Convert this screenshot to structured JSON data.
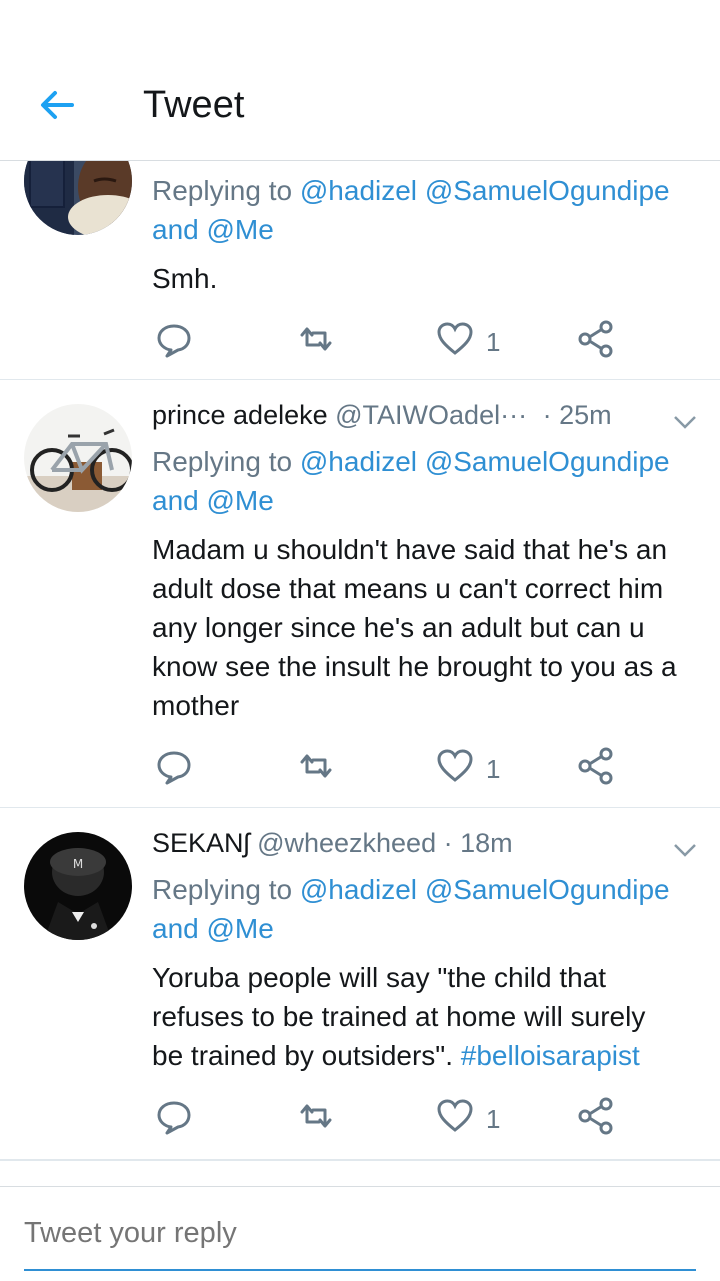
{
  "header": {
    "title": "Tweet",
    "back_icon": "arrow-left-icon",
    "accent": "#1da1f2"
  },
  "tweets": [
    {
      "avatar": "person-avatar",
      "replying_prefix": "Replying to",
      "mention1": "@hadizel",
      "mention2": "@SamuelOgundipe",
      "and": "and",
      "mention3": "@Me",
      "text": "Smh.",
      "likes": "1"
    },
    {
      "name": "prince adeleke",
      "handle": "@TAIWOadel···",
      "time": "· 25m",
      "avatar": "bicycle-avatar",
      "replying_prefix": "Replying to",
      "mention1": "@hadizel",
      "mention2": "@SamuelOgundipe",
      "and": "and",
      "mention3": "@Me",
      "text": "Madam u shouldn't have said that he's an adult dose that means u can't correct him any longer since he's an adult but can u know see the insult he brought to you as a mother",
      "likes": "1"
    },
    {
      "name": "SEKANʃ",
      "handle": "@wheezkheed",
      "time": "· 18m",
      "avatar": "dark-figure-avatar",
      "replying_prefix": "Replying to",
      "mention1": "@hadizel",
      "mention2": "@SamuelOgundipe",
      "and": "and",
      "mention3": "@Me",
      "text": "Yoruba people will say \"the child that refuses to be trained at home will surely be trained by outsiders\".",
      "hashtag": "#belloisarapist",
      "likes": "1"
    }
  ],
  "compose": {
    "placeholder": "Tweet your reply"
  },
  "colors": {
    "link": "#2f8fd3",
    "icon": "#657786",
    "text": "#14171a",
    "divider": "#e1e8ed"
  }
}
